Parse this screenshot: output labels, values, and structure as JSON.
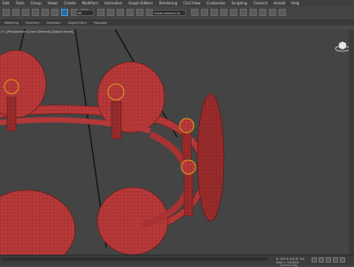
{
  "menu": [
    "Edit",
    "Tools",
    "Group",
    "Views",
    "Create",
    "Modifiers",
    "Animation",
    "Graph Editors",
    "Rendering",
    "Civil View",
    "Customize",
    "Scripting",
    "Content",
    "Arnold",
    "Help"
  ],
  "toolbar": {
    "filter_value": "All",
    "selection_set_value": "Create Selection Se"
  },
  "ribbon_tabs": [
    "Modeling",
    "Freeform",
    "Selection",
    "Object Paint",
    "Populate"
  ],
  "viewport": {
    "label": "[+] [Perspective] [User Defined] [Edged Faces]"
  },
  "status": {
    "coordinates": "X: 0.0  Y: 0.0  Z: 0.0",
    "grid": "Grid = 10.0cm",
    "add_time_tag": "Add Time Tag"
  },
  "colors": {
    "mesh": "#b83a3a",
    "mesh_dark": "#8a2222",
    "highlight": "#d8a020",
    "bg": "#444444"
  }
}
